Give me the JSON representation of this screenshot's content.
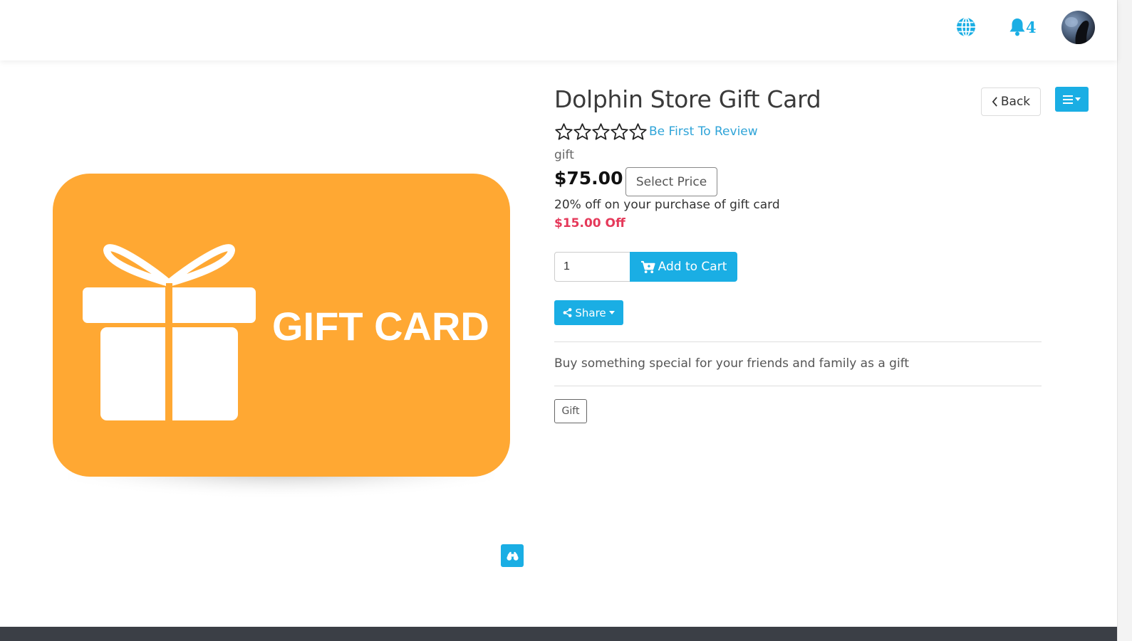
{
  "header": {
    "notification_count": "4"
  },
  "product": {
    "title": "Dolphin Store Gift Card",
    "rating_stars": 0,
    "rating_max": 5,
    "review_link": "Be First To Review",
    "category": "gift",
    "price": "$75.00",
    "select_price_label": "Select Price",
    "promo_text": "20% off on your purchase of gift card",
    "discount_text": "$15.00 Off",
    "image_text": "GIFT CARD",
    "description": "Buy something special for your friends and family as a gift",
    "tag": "Gift"
  },
  "actions": {
    "back_label": "Back",
    "quantity_value": "1",
    "add_to_cart_label": "Add to Cart",
    "share_label": "Share"
  },
  "colors": {
    "accent": "#1aaee4",
    "card_orange": "#ffa833",
    "discount_red": "#e5395a",
    "link_blue": "#2fa4d8"
  },
  "icons": [
    "globe-icon",
    "bell-icon",
    "avatar",
    "chevron-left-icon",
    "hamburger-icon",
    "caret-down-icon",
    "star-outline-icon",
    "cart-plus-icon",
    "share-icon",
    "binoculars-icon"
  ]
}
